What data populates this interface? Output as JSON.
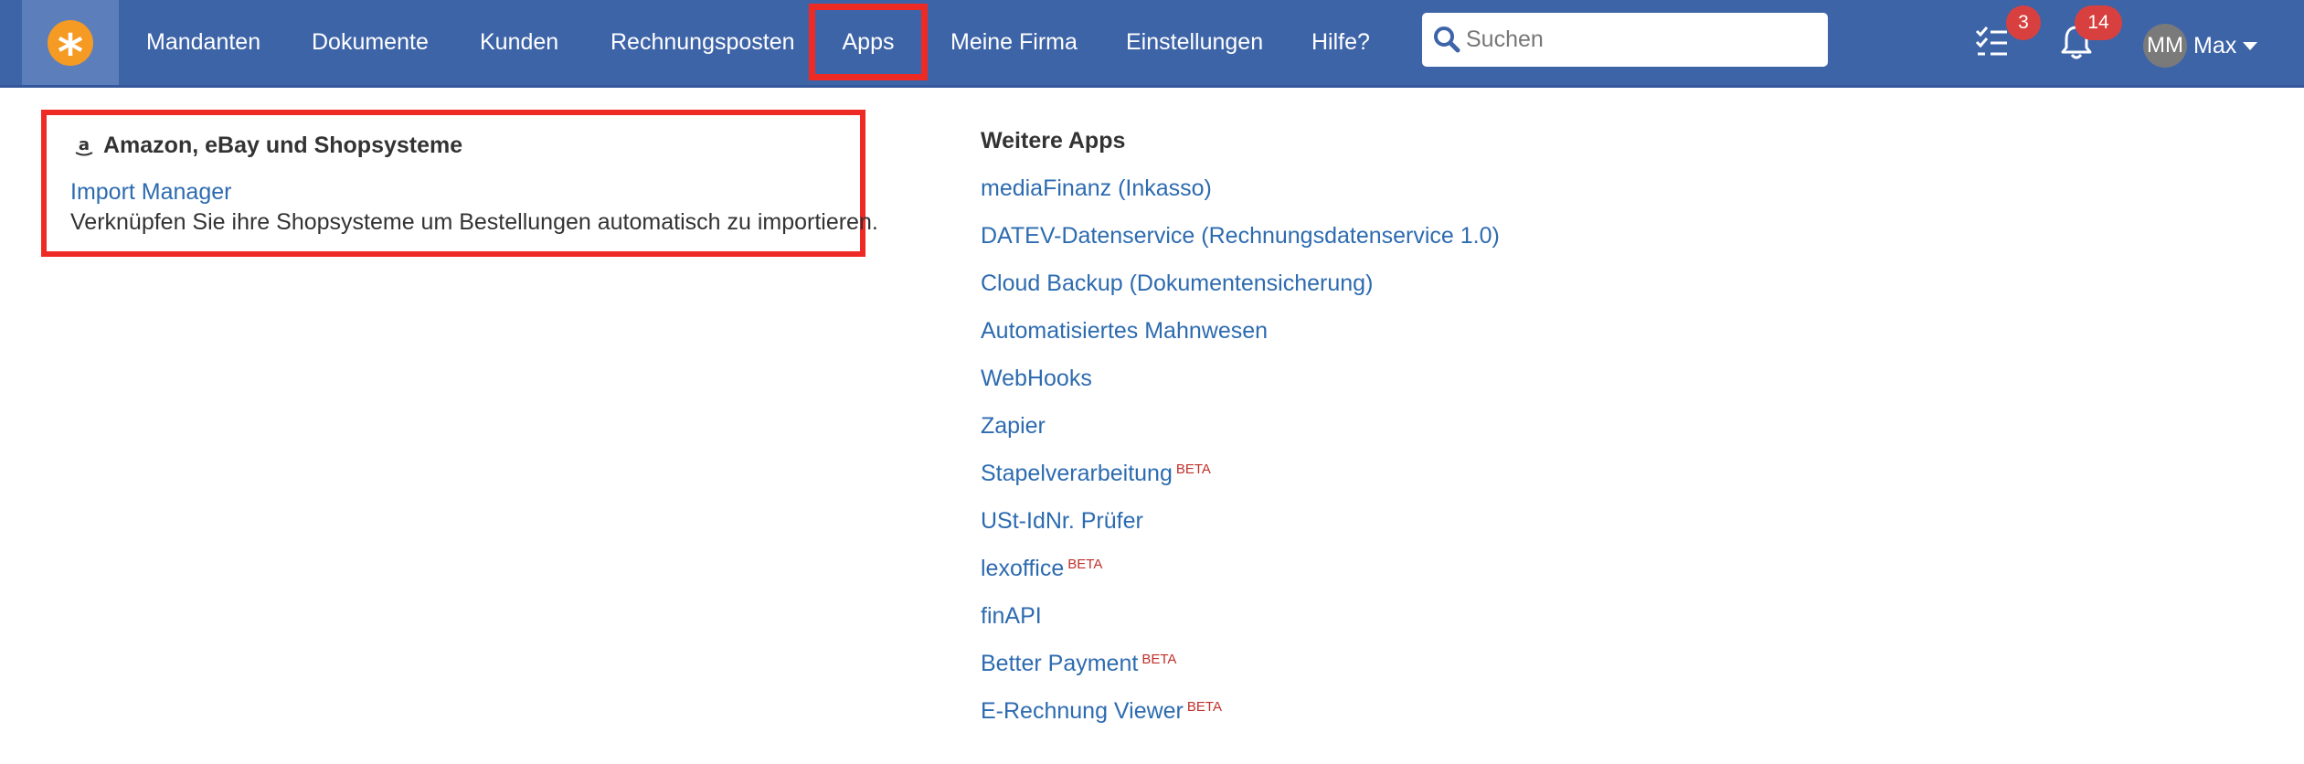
{
  "navbar": {
    "items": [
      {
        "label": "Mandanten"
      },
      {
        "label": "Dokumente"
      },
      {
        "label": "Kunden"
      },
      {
        "label": "Rechnungsposten"
      },
      {
        "label": "Apps"
      },
      {
        "label": "Meine Firma"
      },
      {
        "label": "Einstellungen"
      },
      {
        "label": "Hilfe?"
      }
    ],
    "search_placeholder": "Suchen",
    "tasks_count": "3",
    "notifications_count": "14",
    "avatar_initials": "MM",
    "user_name": "Max",
    "logo_icon": "asterisk-logo-icon",
    "colors": {
      "navbar_bg": "#3e64a8",
      "logo_bg": "#f59a23",
      "badge_bg": "#d84040",
      "highlight": "#ee2a24",
      "link": "#2d6bb0",
      "beta": "#c0302b"
    }
  },
  "apps_menu": {
    "amazon_section": {
      "heading": "Amazon, eBay und Shopsysteme",
      "icon": "amazon-icon",
      "link_label": "Import Manager",
      "description": "Verknüpfen Sie ihre Shopsysteme um Bestellungen automatisch zu importieren."
    },
    "weitere_section": {
      "heading": "Weitere Apps",
      "items": [
        {
          "label": "mediaFinanz (Inkasso)",
          "badge": ""
        },
        {
          "label": "DATEV-Datenservice (Rechnungsdatenservice 1.0)",
          "badge": ""
        },
        {
          "label": "Cloud Backup (Dokumentensicherung)",
          "badge": ""
        },
        {
          "label": "Automatisiertes Mahnwesen",
          "badge": ""
        },
        {
          "label": "WebHooks",
          "badge": ""
        },
        {
          "label": "Zapier",
          "badge": ""
        },
        {
          "label": "Stapelverarbeitung",
          "badge": "BETA"
        },
        {
          "label": "USt-IdNr. Prüfer",
          "badge": ""
        },
        {
          "label": "lexoffice",
          "badge": "BETA"
        },
        {
          "label": "finAPI",
          "badge": ""
        },
        {
          "label": "Better Payment",
          "badge": "BETA"
        },
        {
          "label": "E-Rechnung Viewer",
          "badge": "BETA"
        }
      ]
    }
  }
}
